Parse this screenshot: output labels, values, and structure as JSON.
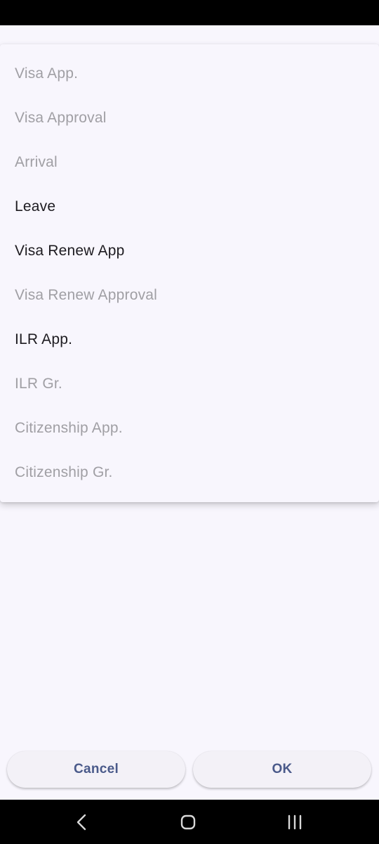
{
  "menu": {
    "items": [
      {
        "label": "Visa App.",
        "enabled": false
      },
      {
        "label": "Visa Approval",
        "enabled": false
      },
      {
        "label": "Arrival",
        "enabled": false
      },
      {
        "label": "Leave",
        "enabled": true
      },
      {
        "label": "Visa Renew App",
        "enabled": true
      },
      {
        "label": "Visa Renew Approval",
        "enabled": false
      },
      {
        "label": "ILR App.",
        "enabled": true
      },
      {
        "label": "ILR Gr.",
        "enabled": false
      },
      {
        "label": "Citizenship App.",
        "enabled": false
      },
      {
        "label": "Citizenship Gr.",
        "enabled": false
      }
    ]
  },
  "actions": {
    "cancel_label": "Cancel",
    "ok_label": "OK"
  },
  "colors": {
    "background": "#f8f6fd",
    "enabled_text": "#1d1b20",
    "disabled_text": "#a09fa4",
    "button_text": "#4a5a8a",
    "button_bg": "#f3f1f7"
  },
  "navigation": {
    "back_icon": "back-chevron-icon",
    "home_icon": "home-icon",
    "recents_icon": "recents-icon"
  }
}
